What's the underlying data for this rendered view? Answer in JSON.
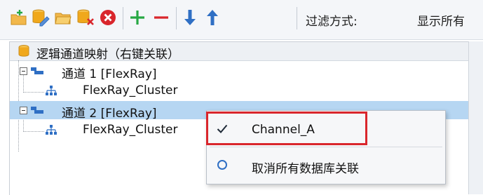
{
  "toolbar": {
    "icons": [
      "add-folder-icon",
      "edit-database-icon",
      "open-folder-icon",
      "delete-database-icon",
      "close-circle-icon",
      "plus-icon",
      "minus-icon",
      "arrow-down-icon",
      "arrow-up-icon"
    ],
    "filter_label": "过滤方式:",
    "filter_value": "显示所有"
  },
  "tree": {
    "header": "逻辑通道映射（右键关联）",
    "nodes": [
      {
        "label": "通道 1 [FlexRay]",
        "child": "FlexRay_Cluster",
        "selected": false
      },
      {
        "label": "通道 2 [FlexRay]",
        "child": "FlexRay_Cluster",
        "selected": true
      }
    ]
  },
  "context_menu": {
    "items": [
      {
        "label": "Channel_A",
        "marker": "check-icon",
        "checked": true
      },
      {
        "label": "取消所有数据库关联",
        "marker": "radio-icon",
        "checked": false
      }
    ]
  },
  "colors": {
    "accent_blue": "#2f6fc4",
    "selection": "#b6d6f2",
    "green": "#27a844",
    "red": "#d9262c",
    "db_yellow": "#f0a81c"
  }
}
